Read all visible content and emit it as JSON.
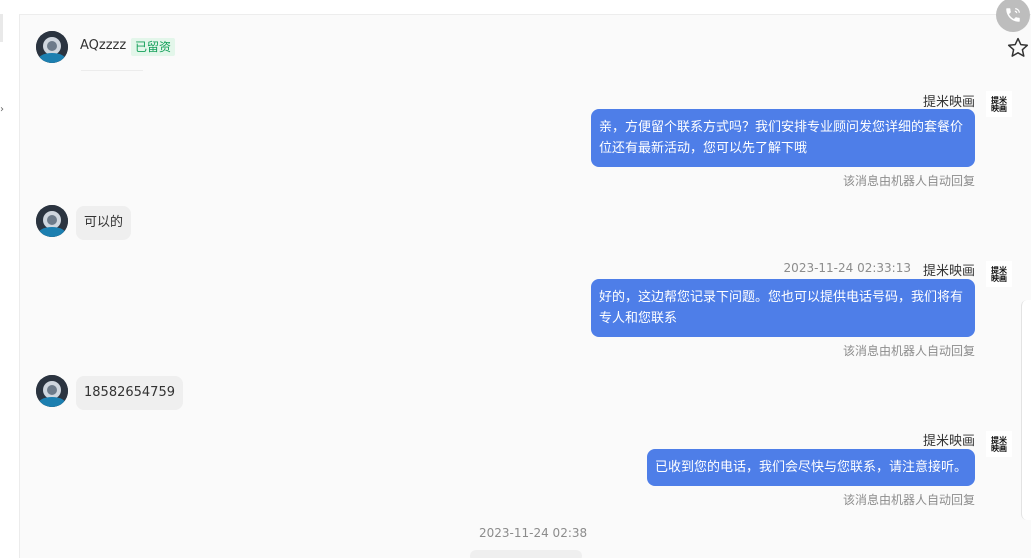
{
  "contact": {
    "name": "AQzzzz",
    "tag": "已留资"
  },
  "messages": {
    "bot1": {
      "sender": "提米映画",
      "text": "亲，方便留个联系方式吗？我们安排专业顾问发您详细的套餐价位还有最新活动，您可以先了解下哦",
      "note": "该消息由机器人自动回复"
    },
    "user1": {
      "text": "可以的"
    },
    "bot2": {
      "time": "2023-11-24 02:33:13",
      "sender": "提米映画",
      "text": "好的，这边帮您记录下问题。您也可以提供电话号码，我们将有专人和您联系",
      "note": "该消息由机器人自动回复"
    },
    "user2": {
      "text": "18582654759"
    },
    "bot3": {
      "sender": "提米映画",
      "text": "已收到您的电话，我们会尽快与您联系，请注意接听。",
      "note": "该消息由机器人自动回复"
    },
    "divider_time": "2023-11-24 02:38"
  },
  "bot_logo": {
    "line1": "提米",
    "line2": "映画"
  },
  "icons": {
    "call": "phone-icon",
    "favorite": "star-outline-icon"
  },
  "colors": {
    "bot_bubble": "#4e7ee8",
    "user_bubble": "#efefef",
    "tag_text": "#14a05a",
    "tag_bg": "#e3f6ea"
  }
}
